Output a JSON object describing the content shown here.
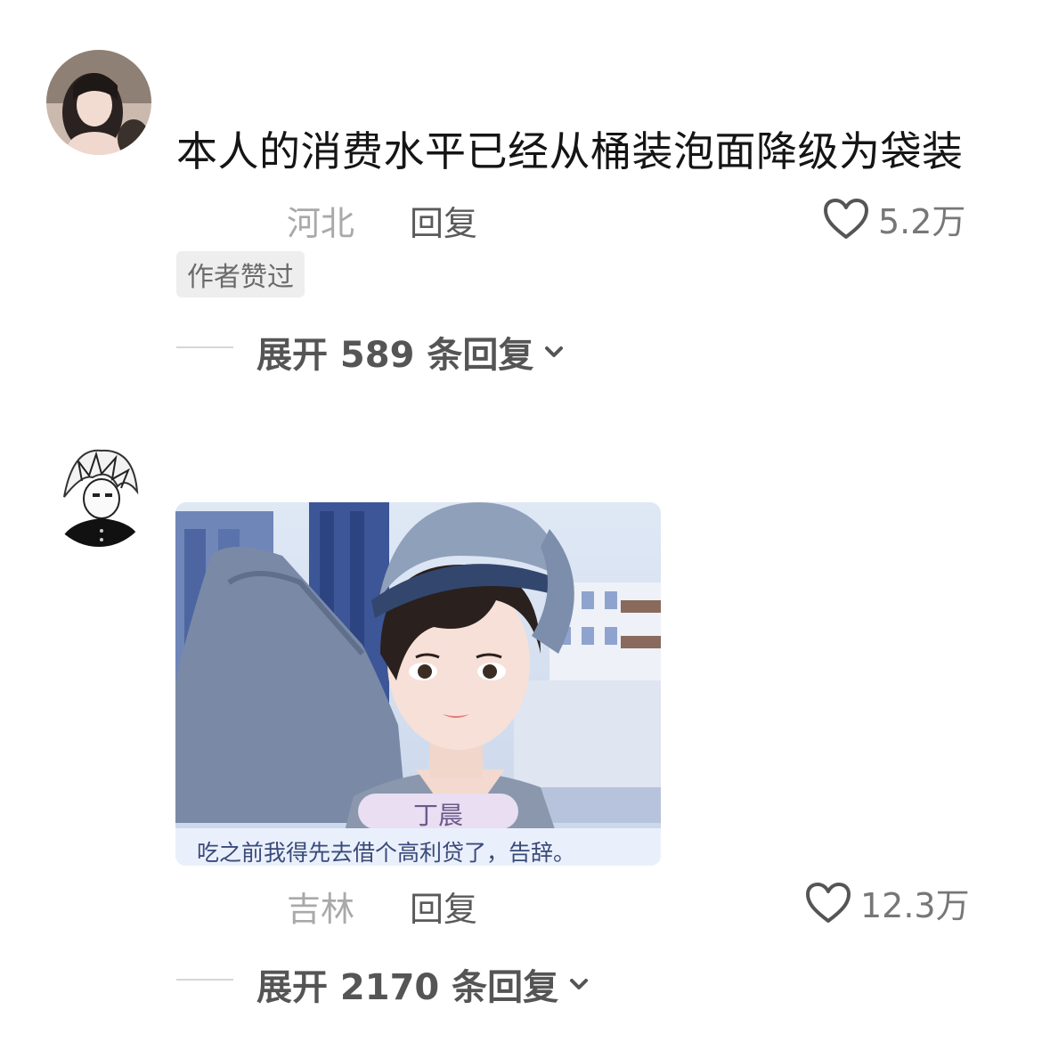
{
  "comments": [
    {
      "text": "本人的消费水平已经从桶装泡面降级为袋装",
      "location": "河北",
      "reply_label": "回复",
      "likes": "5.2万",
      "badge": "作者赞过",
      "expand_label": "展开 589 条回复"
    },
    {
      "location": "吉林",
      "reply_label": "回复",
      "likes": "12.3万",
      "expand_label": "展开 2170 条回复",
      "image": {
        "character_name": "丁晨",
        "dialogue": "吃之前我得先去借个高利贷了，告辞。"
      }
    }
  ],
  "icons": {
    "like": "heart-outline-icon",
    "expand": "chevron-down-icon"
  },
  "colors": {
    "text": "#151515",
    "meta": "#a9a9a9",
    "reply": "#5a5a5a",
    "badge_bg": "#eeeeee"
  }
}
